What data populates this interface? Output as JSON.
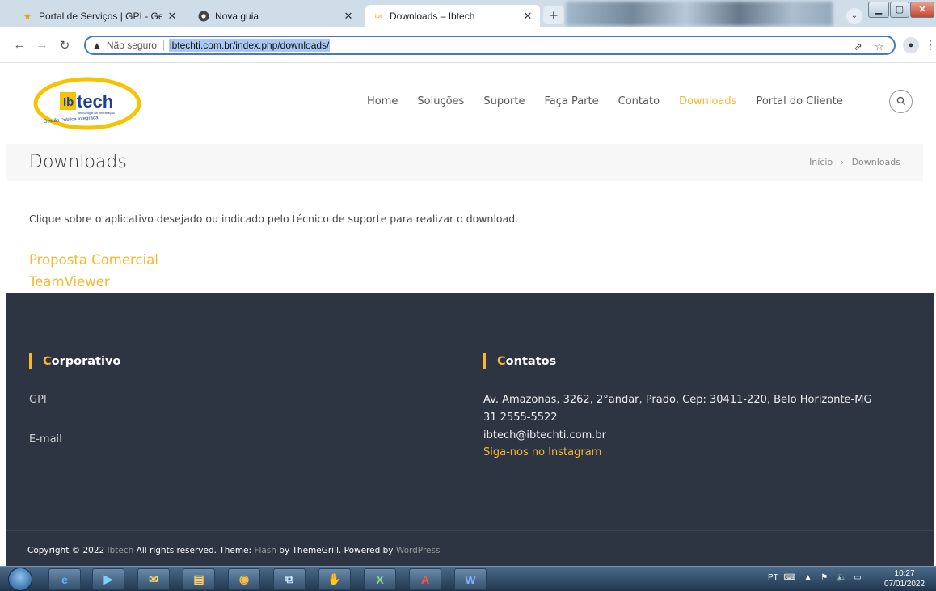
{
  "browser": {
    "tabs": [
      {
        "title": "Portal de Serviços | GPI - Gestão",
        "icon": "star-favicon"
      },
      {
        "title": "Nova guia",
        "icon": "chrome-favicon"
      },
      {
        "title": "Downloads – Ibtech",
        "icon": "ibtech-favicon"
      }
    ],
    "active_tab": 2,
    "security_label": "Não seguro",
    "url": "ibtechti.com.br/index.php/downloads/"
  },
  "site": {
    "logo_text": "Ibtech",
    "logo_sub": "Tecnologia da Informação",
    "logo_slogan": "Gestão Pública Integrada",
    "nav": [
      "Home",
      "Soluções",
      "Suporte",
      "Faça Parte",
      "Contato",
      "Downloads",
      "Portal do Cliente"
    ],
    "nav_active": "Downloads",
    "page_title": "Downloads",
    "breadcrumb": {
      "home": "Início",
      "separator": "›",
      "current": "Downloads"
    },
    "intro": "Clique sobre o aplicativo desejado ou indicado pelo técnico de suporte para realizar o download.",
    "downloads": [
      "Proposta Comercial",
      "TeamViewer"
    ]
  },
  "footer": {
    "corporativo": {
      "heading_first": "C",
      "heading_rest": "orporativo",
      "links": [
        "GPI",
        "E-mail"
      ]
    },
    "contatos": {
      "heading_first": "C",
      "heading_rest": "ontatos",
      "address": "Av. Amazonas, 3262, 2°andar, Prado, Cep: 30411-220, Belo Horizonte-MG",
      "phone": "31 2555-5522",
      "email": "ibtech@ibtechti.com.br",
      "instagram": "Siga-nos no Instagram"
    },
    "copyright": {
      "prefix": "Copyright © 2022",
      "site": "Ibtech",
      "rights": "All rights reserved. Theme:",
      "theme": "Flash",
      "by": "by ThemeGrill. Powered by",
      "platform": "WordPress"
    }
  },
  "taskbar": {
    "language": "PT",
    "time": "10:27",
    "date": "07/01/2022"
  },
  "colors": {
    "accent": "#f7b731",
    "footer_bg": "#2e3542",
    "omnibox_border": "#4a78c2"
  }
}
